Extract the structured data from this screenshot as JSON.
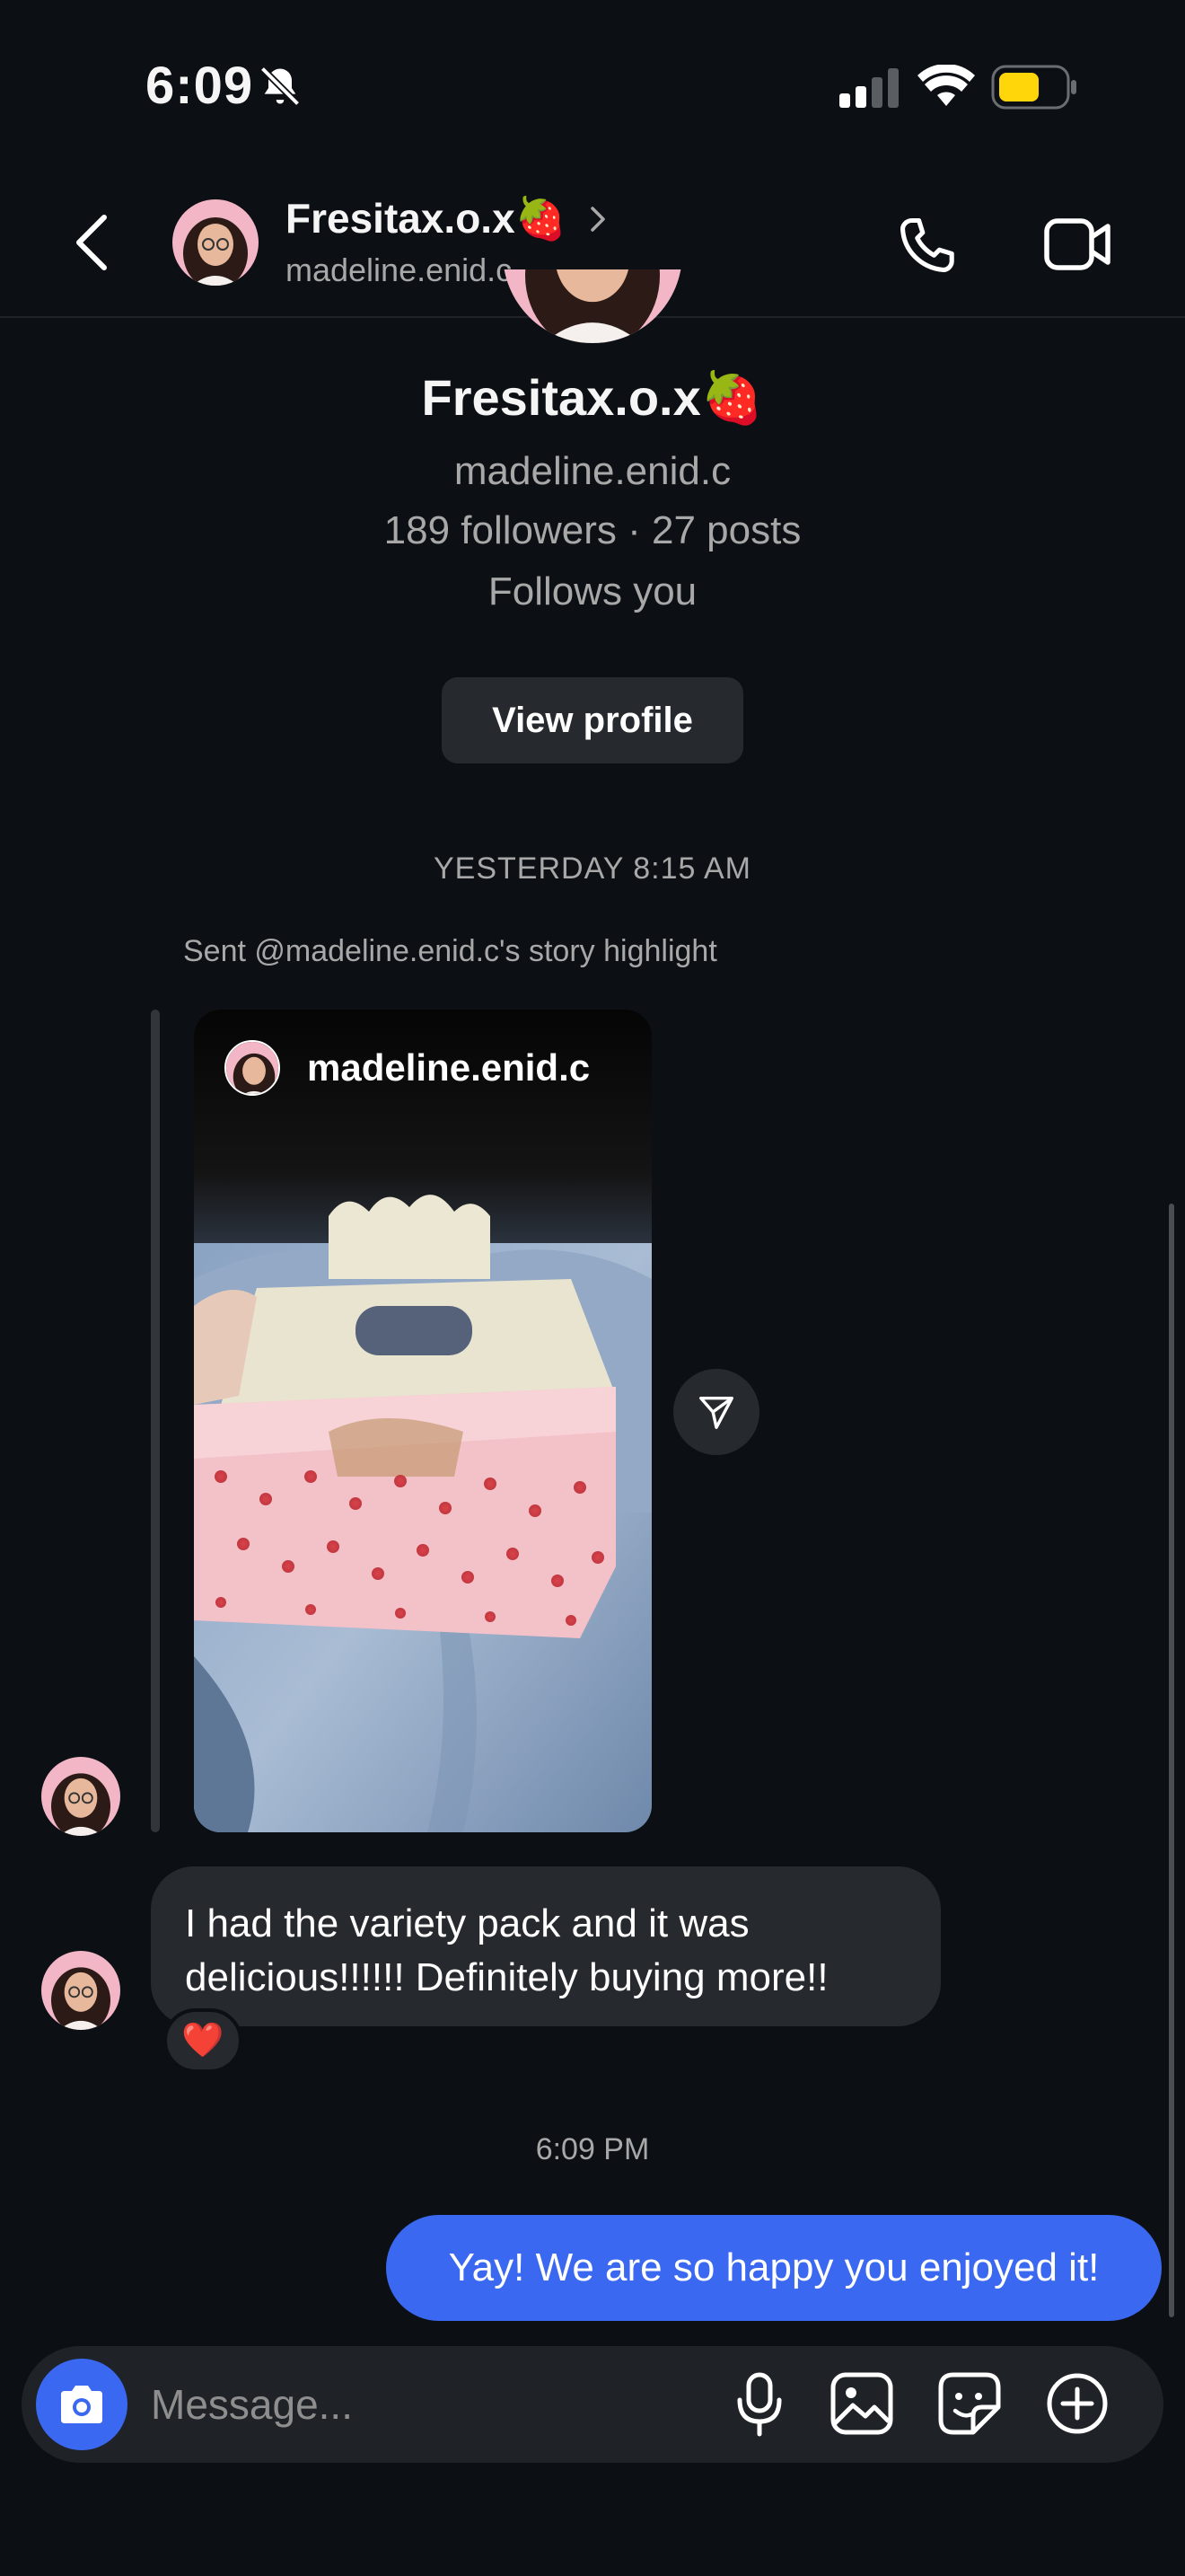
{
  "status_bar": {
    "time": "6:09",
    "icons": [
      "bell-slash-icon",
      "signal-icon",
      "wifi-icon",
      "battery-icon"
    ]
  },
  "header": {
    "name": "Fresitax.o.x🍓",
    "username": "madeline.enid.c",
    "icons": [
      "back-icon",
      "chevron-right-icon",
      "phone-icon",
      "video-icon"
    ]
  },
  "profile": {
    "name": "Fresitax.o.x🍓",
    "username": "madeline.enid.c",
    "stats": "189 followers · 27 posts",
    "follows": "Follows you",
    "view_profile_label": "View profile"
  },
  "conversation": {
    "timestamp_1": "YESTERDAY 8:15 AM",
    "story_caption": "Sent @madeline.enid.c's story highlight",
    "story_owner": "madeline.enid.c",
    "incoming_message": "I had the variety pack and it was delicious!!!!!! Definitely buying more!!",
    "reaction": "❤️",
    "timestamp_2": "6:09 PM",
    "outgoing_message": "Yay! We are so happy you enjoyed it!"
  },
  "composer": {
    "placeholder": "Message...",
    "icons": [
      "camera-icon",
      "microphone-icon",
      "gallery-icon",
      "sticker-icon",
      "plus-icon"
    ]
  },
  "colors": {
    "background": "#0c1014",
    "bubble_incoming": "#26292d",
    "bubble_outgoing": "#3a68f0",
    "accent_blue": "#3a68f0",
    "battery_yellow": "#ffd60a",
    "secondary_text": "#a8a8a8"
  }
}
